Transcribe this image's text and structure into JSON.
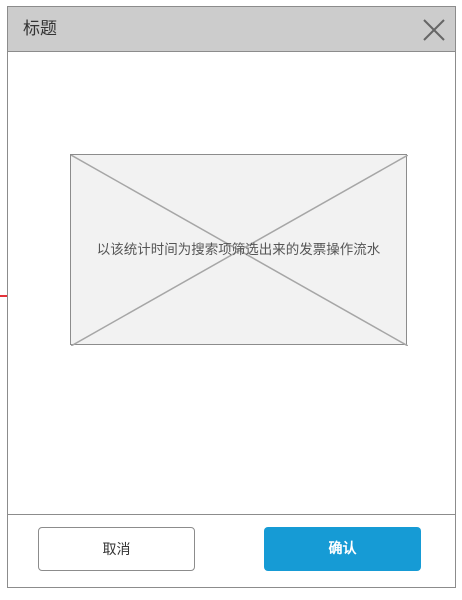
{
  "dialog": {
    "title": "标题",
    "close_icon": "close-icon",
    "placeholder_text": "以该统计时间为搜索项筛选出来的发票操作流水",
    "buttons": {
      "cancel_label": "取消",
      "confirm_label": "确认"
    }
  },
  "colors": {
    "header_bg": "#cccccc",
    "border": "#8c8c8c",
    "placeholder_bg": "#f2f2f2",
    "primary": "#169bd5",
    "side_mark": "#e5323a"
  }
}
